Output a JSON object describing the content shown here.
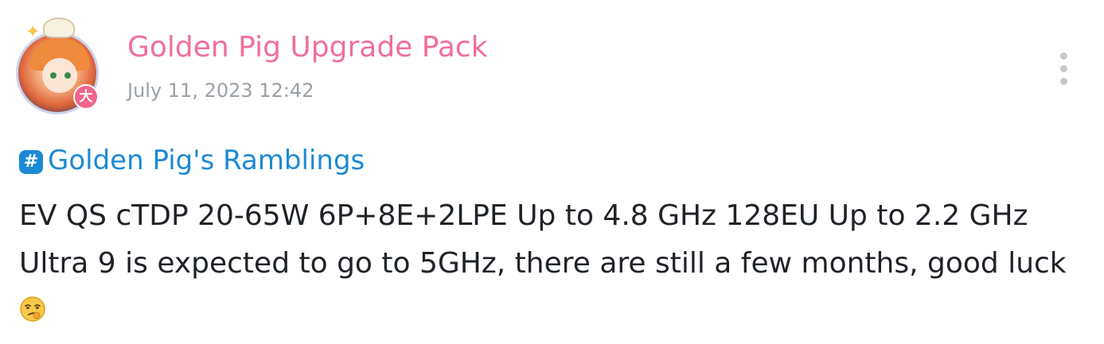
{
  "author": {
    "name": "Golden Pig Upgrade Pack",
    "badge_glyph": "大",
    "name_color": "#f06f9a"
  },
  "post": {
    "time": "July 11, 2023 12:42",
    "topic": {
      "icon": "hash-icon",
      "icon_glyph": "#",
      "label": "Golden Pig's Ramblings",
      "color": "#1b8ad3"
    },
    "lines": [
      "EV QS cTDP 20-65W 6P+8E+2LPE Up to 4.8 GHz 128EU Up to 2.2 GHz",
      "Ultra 9 is expected to go to 5GHz, there are still a few months, good luck"
    ],
    "emoji": "smirking-face-emoji"
  },
  "menu": {
    "icon": "more-vertical-icon"
  }
}
